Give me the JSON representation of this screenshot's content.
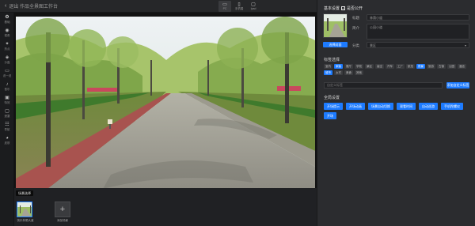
{
  "topbar": {
    "back_icon": "arrow-left-icon",
    "title": "退出  作品全景图工作台"
  },
  "devices": [
    {
      "icon": "pc-icon",
      "label": "PC",
      "active": true
    },
    {
      "icon": "mobile-icon",
      "label": "手机端",
      "active": false
    },
    {
      "icon": "pad-icon",
      "label": "Ipad",
      "active": false
    }
  ],
  "leftnav": [
    {
      "icon": "gear-icon",
      "label": "基础",
      "active": true
    },
    {
      "icon": "eye-icon",
      "label": "视角"
    },
    {
      "icon": "hotspot-icon",
      "label": "热点"
    },
    {
      "icon": "layers-icon",
      "label": "沙盘"
    },
    {
      "icon": "chat-icon",
      "label": "说一说"
    },
    {
      "icon": "music-icon",
      "label": "音乐"
    },
    {
      "icon": "image-icon",
      "label": "特效"
    },
    {
      "icon": "square-icon",
      "label": "遮罩"
    },
    {
      "icon": "tree-icon",
      "label": "导航"
    },
    {
      "icon": "palette-icon",
      "label": "皮肤"
    }
  ],
  "bottom": {
    "tag": "场景选择",
    "scene_label": "快乐林荫大道",
    "add_icon": "plus-icon",
    "add_label": "添加场景"
  },
  "panel": {
    "title": "基本设置",
    "share_label": "是否公开",
    "share_checked": true,
    "cover_button": "选择封面",
    "name_label": "标题",
    "name_value": "林荫小道",
    "desc_label": "简介",
    "desc_value": "公园小道",
    "category_label": "分类",
    "category_value": "景区",
    "tags_title": "标签选择",
    "tags": [
      {
        "label": "室内",
        "sel": false
      },
      {
        "label": "家装",
        "sel": true
      },
      {
        "label": "展厅",
        "sel": false
      },
      {
        "label": "学校",
        "sel": false
      },
      {
        "label": "景区",
        "sel": false
      },
      {
        "label": "高空",
        "sel": false
      },
      {
        "label": "汽车",
        "sel": false
      },
      {
        "label": "工厂",
        "sel": false
      },
      {
        "label": "航拍",
        "sel": false
      },
      {
        "label": "夜景",
        "sel": true
      },
      {
        "label": "旅游",
        "sel": false
      },
      {
        "label": "古镇",
        "sel": false
      },
      {
        "label": "公园",
        "sel": false
      },
      {
        "label": "酒店",
        "sel": false
      },
      {
        "label": "城市",
        "sel": true
      },
      {
        "label": "乡村",
        "sel": false
      },
      {
        "label": "美食",
        "sel": false
      },
      {
        "label": "其他",
        "sel": false
      }
    ],
    "custom_placeholder": "自定义标签",
    "custom_button": "添加自定义标签",
    "global_title": "全局设置",
    "global_buttons": [
      "开场提示",
      "开场动画",
      "场景自动切换",
      "观看时间",
      "自动巡游",
      "手机陀螺仪",
      "开场"
    ]
  },
  "colors": {
    "accent": "#1d7bff",
    "panel": "#2b2c2f",
    "background": "#202124"
  }
}
